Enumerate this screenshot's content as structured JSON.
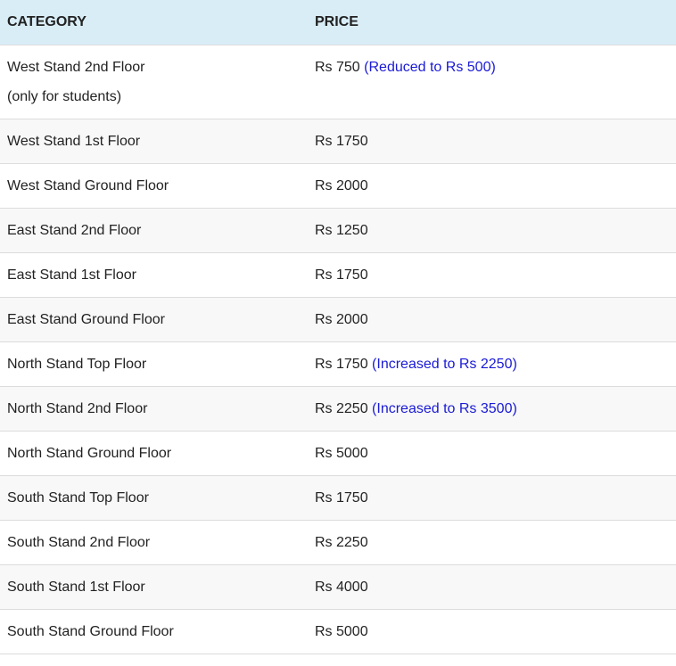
{
  "table": {
    "headers": {
      "category": "CATEGORY",
      "price": "PRICE"
    },
    "rows": [
      {
        "category": "West Stand 2nd Floor",
        "category_sub": "(only for students)",
        "price": "Rs 750",
        "note": "(Reduced to Rs 500)"
      },
      {
        "category": "West Stand 1st Floor",
        "price": "Rs 1750"
      },
      {
        "category": "West Stand Ground Floor",
        "price": "Rs 2000"
      },
      {
        "category": "East Stand 2nd Floor",
        "price": "Rs 1250"
      },
      {
        "category": "East Stand 1st Floor",
        "price": "Rs 1750"
      },
      {
        "category": "East Stand Ground Floor",
        "price": "Rs 2000"
      },
      {
        "category": "North Stand Top Floor",
        "price": "Rs 1750",
        "note": "(Increased to Rs 2250)"
      },
      {
        "category": "North Stand 2nd Floor",
        "price": "Rs 2250",
        "note": "(Increased to Rs 3500)"
      },
      {
        "category": "North Stand Ground Floor",
        "price": "Rs 5000"
      },
      {
        "category": "South Stand Top Floor",
        "price": "Rs 1750"
      },
      {
        "category": "South Stand 2nd Floor",
        "price": "Rs 2250"
      },
      {
        "category": "South Stand 1st Floor",
        "price": "Rs 4000"
      },
      {
        "category": "South Stand Ground Floor",
        "price": "Rs 5000"
      }
    ]
  },
  "colors": {
    "header_background": "#d9edf7",
    "stripe_background": "#f8f8f8",
    "note_text": "#1a1ad6",
    "border": "#dcdcdc"
  }
}
